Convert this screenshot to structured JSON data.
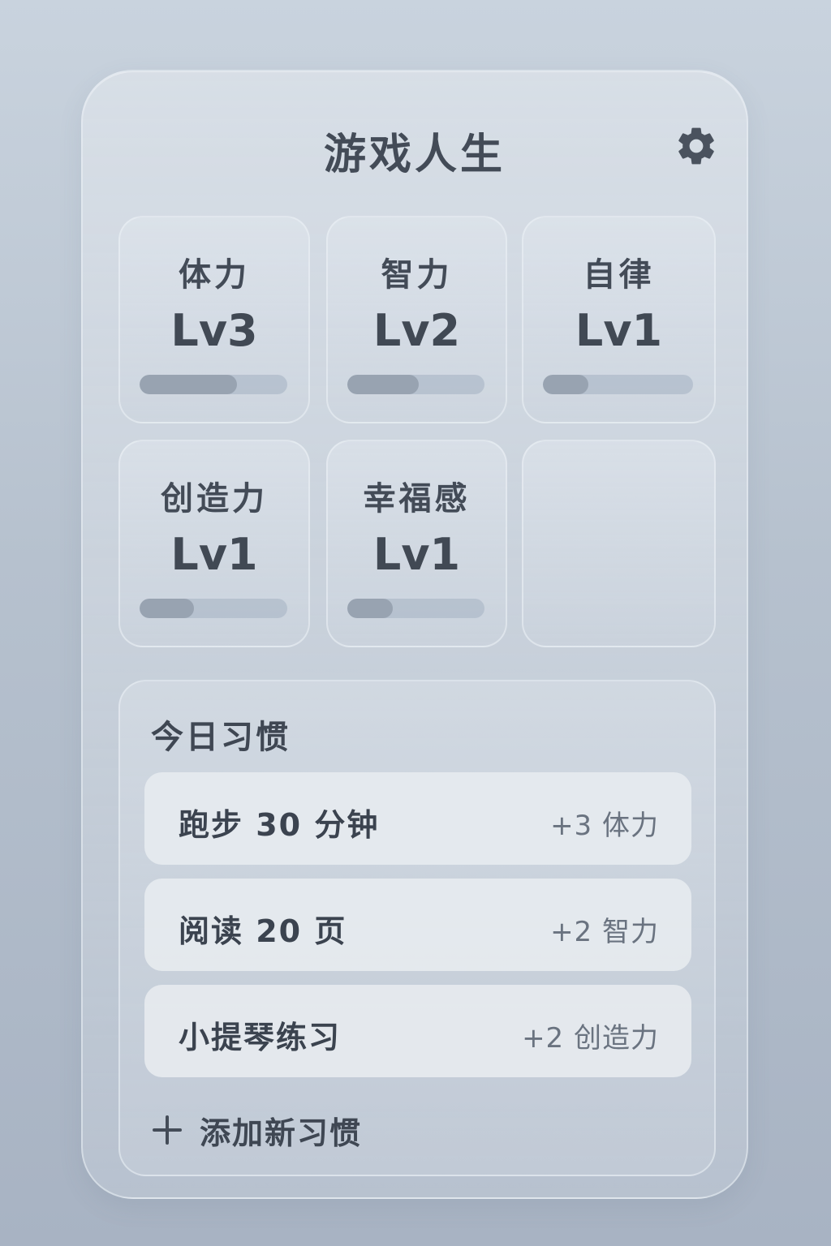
{
  "app": {
    "title": "游戏人生",
    "settings_icon": "gear-icon"
  },
  "stats": [
    {
      "name": "体力",
      "level": "Lv3",
      "progress": 0.66
    },
    {
      "name": "智力",
      "level": "Lv2",
      "progress": 0.52
    },
    {
      "name": "自律",
      "level": "Lv1",
      "progress": 0.3
    },
    {
      "name": "创造力",
      "level": "Lv1",
      "progress": 0.37
    },
    {
      "name": "幸福感",
      "level": "Lv1",
      "progress": 0.33
    }
  ],
  "habits": {
    "title": "今日习惯",
    "items": [
      {
        "label": "跑步 30 分钟",
        "reward": "+3 体力"
      },
      {
        "label": "阅读 20 页",
        "reward": "+2 智力"
      },
      {
        "label": "小提琴练习",
        "reward": "+2 创造力"
      }
    ],
    "add_label": "添加新习惯",
    "add_icon": "plus-icon"
  },
  "colors": {
    "background_top": "#c9d3de",
    "background_bottom": "#a8b3c3",
    "text_primary": "#3f4753",
    "bar_fill": "#98a3b1",
    "bar_track": "#afbbc9"
  }
}
